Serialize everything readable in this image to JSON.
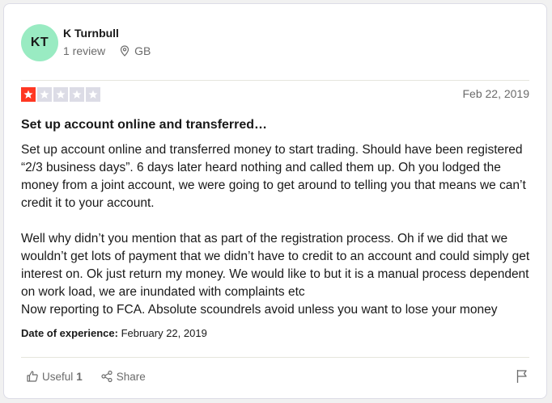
{
  "reviewer": {
    "initials": "KT",
    "name": "K Turnbull",
    "reviews": "1 review",
    "country": "GB",
    "avatar_color": "#99ebc2"
  },
  "review": {
    "rating": 1,
    "max_rating": 5,
    "star_color": "#ff3722",
    "date": "Feb 22, 2019",
    "title": "Set up account online and transferred…",
    "paragraph1": "Set up account online and transferred money to start trading. Should have been registered “2/3 business days”. 6 days later heard nothing and called them up. Oh you lodged the money from a joint account, we were going to get around to telling you that means we can’t credit it to your account.",
    "paragraph2": "Well why didn’t you mention that as part of the registration process. Oh if we did that we wouldn’t get lots of payment that we didn’t have to credit to an account and could simply get interest on. Ok just return my money. We would like to but it is a manual process dependent on work load, we are inundated with complaints etc",
    "paragraph3": "Now reporting to FCA. Absolute scoundrels avoid unless you want to lose your money",
    "experience_label": "Date of experience:",
    "experience_date": "February 22, 2019"
  },
  "actions": {
    "useful_label": "Useful",
    "useful_count": "1",
    "share_label": "Share",
    "useful_icon": "thumbs-up-icon",
    "share_icon": "share-icon",
    "flag_icon": "flag-icon"
  }
}
